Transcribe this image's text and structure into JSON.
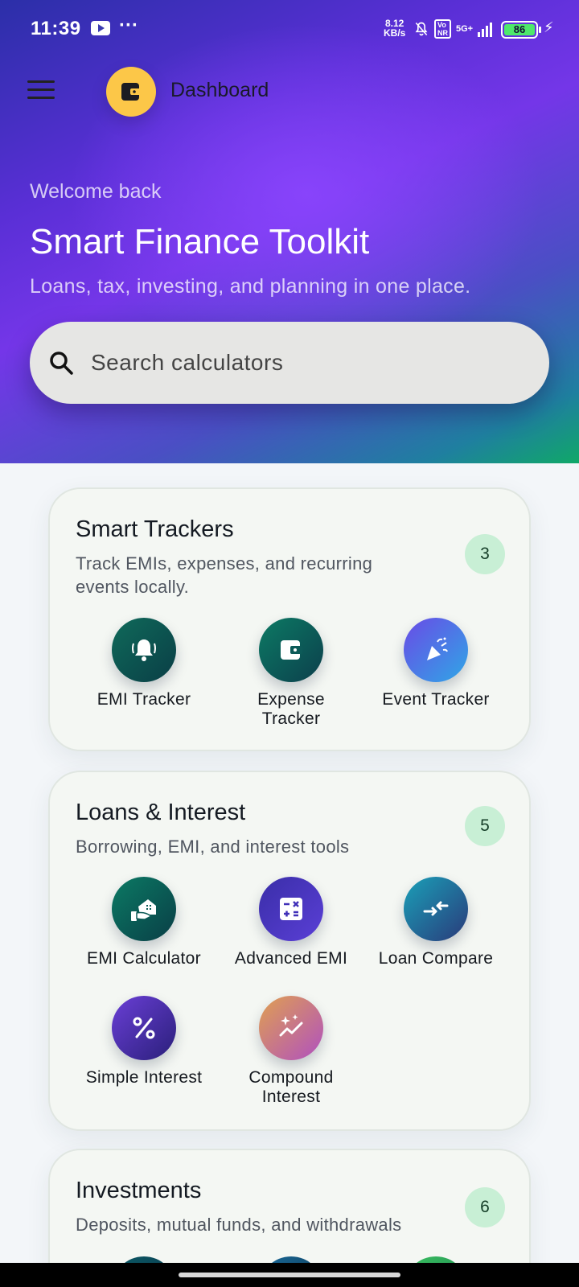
{
  "status_bar": {
    "time": "11:39",
    "dots": "···",
    "net_speed_value": "8.12",
    "net_speed_unit": "KB/s",
    "volte": "Vo\nNR",
    "network": "5G+",
    "battery_level": "86",
    "charging_icon": "bolt-icon"
  },
  "header": {
    "menu_icon": "hamburger-menu-icon",
    "logo_icon": "wallet-icon",
    "title": "Dashboard"
  },
  "hero": {
    "welcome": "Welcome back",
    "headline": "Smart Finance Toolkit",
    "tagline": "Loans, tax, investing, and planning in one place."
  },
  "search": {
    "placeholder": "Search calculators",
    "icon": "search-icon"
  },
  "sections": [
    {
      "title": "Smart Trackers",
      "subtitle_line1": "Track EMIs, expenses, and recurring",
      "subtitle_line2": "events locally.",
      "count": "3",
      "tools": [
        {
          "line1": "EMI Tracker",
          "line2": "",
          "icon": "bell-icon"
        },
        {
          "line1": "Expense",
          "line2": "Tracker",
          "icon": "wallet-icon"
        },
        {
          "line1": "Event Tracker",
          "line2": "",
          "icon": "party-popper-icon"
        }
      ]
    },
    {
      "title": "Loans & Interest",
      "subtitle_line1": "Borrowing, EMI, and interest tools",
      "count": "5",
      "tools": [
        {
          "line1": "EMI Calculator",
          "line2": "",
          "icon": "home-loan-icon"
        },
        {
          "line1": "Advanced EMI",
          "line2": "",
          "icon": "calculator-icon"
        },
        {
          "line1": "Loan Compare",
          "line2": "",
          "icon": "compare-arrows-icon"
        },
        {
          "line1": "Simple Interest",
          "line2": "",
          "icon": "percent-icon"
        },
        {
          "line1": "Compound",
          "line2": "Interest",
          "icon": "sparkle-trend-icon"
        }
      ]
    },
    {
      "title": "Investments",
      "subtitle_line1": "Deposits, mutual funds, and withdrawals",
      "count": "6"
    }
  ],
  "colors": {
    "accent_yellow": "#fcc748",
    "badge_bg": "#c8efd5",
    "hero_start": "#2b2fa8",
    "hero_end": "#10a868"
  }
}
